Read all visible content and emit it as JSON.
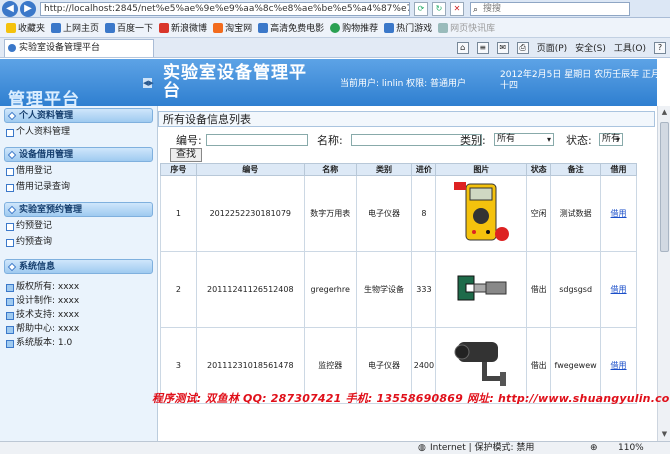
{
  "browser": {
    "url": "http://localhost:2845/net%e5%ae%9e%e9%aa%8c%e8%ae%be%e5%a4%87%e7%",
    "search_placeholder": "搜搜",
    "favorites": [
      "收藏夹",
      "上网主页",
      "百度一下",
      "新浪微博",
      "淘宝网",
      "高清免费电影",
      "购物推荐",
      "热门游戏",
      "网页快讯库"
    ],
    "tab_title": "实验室设备管理平台",
    "cmd": {
      "page": "页面(P)",
      "safety": "安全(S)",
      "tools": "工具(O)"
    }
  },
  "header": {
    "logo": "管理平台",
    "title": "实验室设备管理平台",
    "user_text": "当前用户: linlin 权限: 普通用户",
    "date_text": "2012年2月5日 星期日 农历壬辰年 正月十四"
  },
  "sidebar": {
    "sections": [
      {
        "title": "个人资料管理",
        "items": [
          "个人资料管理"
        ]
      },
      {
        "title": "设备借用管理",
        "items": [
          "借用登记",
          "借用记录查询"
        ]
      },
      {
        "title": "实验室预约管理",
        "items": [
          "约预登记",
          "约预查询"
        ]
      }
    ],
    "sysinfo": {
      "title": "系统信息",
      "lines": [
        "版权所有: xxxx",
        "设计制作: xxxx",
        "技术支持: xxxx",
        "帮助中心: xxxx",
        "系统版本: 1.0"
      ]
    }
  },
  "main": {
    "panel_title": "所有设备信息列表",
    "filter": {
      "code_label": "编号:",
      "name_label": "名称:",
      "category_label": "类别:",
      "category_value": "所有",
      "status_label": "状态:",
      "status_value": "所有",
      "query": "查找"
    },
    "columns": [
      "序号",
      "编号",
      "名称",
      "类别",
      "进价",
      "图片",
      "状态",
      "备注",
      "借用"
    ],
    "rows": [
      {
        "seq": "1",
        "code": "2012252230181079",
        "name": "数字万用表",
        "category": "电子仪器",
        "price": "8",
        "image": "multimeter",
        "status": "空闲",
        "note": "测试数据",
        "action": "借用"
      },
      {
        "seq": "2",
        "code": "20111241126512408",
        "name": "gregerhre",
        "category": "生物学设备",
        "price": "333",
        "image": "micrometer",
        "status": "借出",
        "note": "sdgsgsd",
        "action": "借用"
      },
      {
        "seq": "3",
        "code": "20111231018561478",
        "name": "监控器",
        "category": "电子仪器",
        "price": "2400",
        "image": "camera",
        "status": "借出",
        "note": "fwegewew",
        "action": "借用"
      }
    ]
  },
  "watermark": "程序测试: 双鱼林    QQ: 287307421    手机: 13558690869    网址: http://www.shuangyulin.com",
  "status": {
    "zone": "Internet | 保护模式: 禁用",
    "zoom": "110%"
  }
}
